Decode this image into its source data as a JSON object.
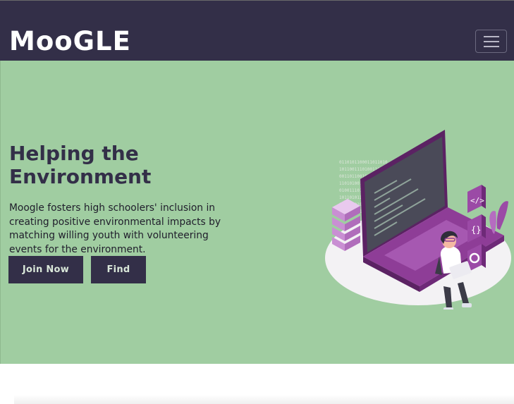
{
  "navbar": {
    "brand": "MooGLE",
    "toggle_icon": "hamburger-menu-icon"
  },
  "hero": {
    "title": "Helping the Environment",
    "description": "Moogle fosters high schoolers' inclusion in creating positive environmental impacts by matching willing youth with volunteering events for the environment.",
    "join_label": "Join Now",
    "find_label": "Find",
    "illustration": "woman-with-laptop-coding-illustration"
  },
  "colors": {
    "navbar_bg": "#332f48",
    "hero_bg": "#a0cda1",
    "button_bg": "#332f48",
    "accent_purple": "#8e3d97"
  }
}
